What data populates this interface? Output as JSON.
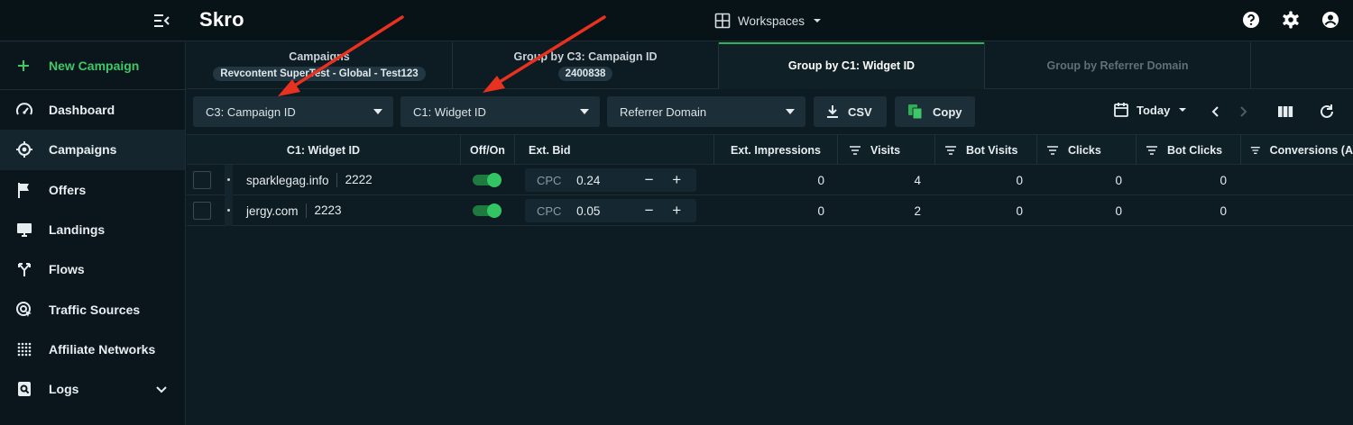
{
  "app": {
    "name": "Skro"
  },
  "header": {
    "workspaces_label": "Workspaces"
  },
  "sidebar": {
    "new_campaign": "New Campaign",
    "items": [
      {
        "label": "Dashboard"
      },
      {
        "label": "Campaigns"
      },
      {
        "label": "Offers"
      },
      {
        "label": "Landings"
      },
      {
        "label": "Flows"
      },
      {
        "label": "Traffic Sources"
      },
      {
        "label": "Affiliate Networks"
      },
      {
        "label": "Logs"
      }
    ]
  },
  "tabs": [
    {
      "label": "Campaigns",
      "badge": "Revcontent SuperTest - Global - Test123"
    },
    {
      "label": "Group by C3: Campaign ID",
      "badge": "2400838"
    },
    {
      "label": "Group by C1: Widget ID"
    },
    {
      "label": "Group by Referrer Domain"
    }
  ],
  "toolbar": {
    "group1": "C3: Campaign ID",
    "group2": "C1: Widget ID",
    "group3": "Referrer Domain",
    "csv_label": "CSV",
    "copy_label": "Copy",
    "date_label": "Today"
  },
  "table": {
    "columns": [
      "C1: Widget ID",
      "Off/On",
      "Ext. Bid",
      "Ext. Impressions",
      "Visits",
      "Bot Visits",
      "Clicks",
      "Bot Clicks",
      "Conversions (A"
    ],
    "rows": [
      {
        "domain": "sparklegag.info",
        "widget_id": "2222",
        "enabled": true,
        "bid_type": "CPC",
        "bid": "0.24",
        "impressions": "0",
        "visits": "4",
        "bot_visits": "0",
        "clicks": "0",
        "bot_clicks": "0"
      },
      {
        "domain": "jergy.com",
        "widget_id": "2223",
        "enabled": true,
        "bid_type": "CPC",
        "bid": "0.05",
        "impressions": "0",
        "visits": "2",
        "bot_visits": "0",
        "clicks": "0",
        "bot_clicks": "0"
      }
    ]
  },
  "colors": {
    "accent": "#3ec867",
    "background": "#0d1b22",
    "annotation_arrow": "#e8311f"
  }
}
